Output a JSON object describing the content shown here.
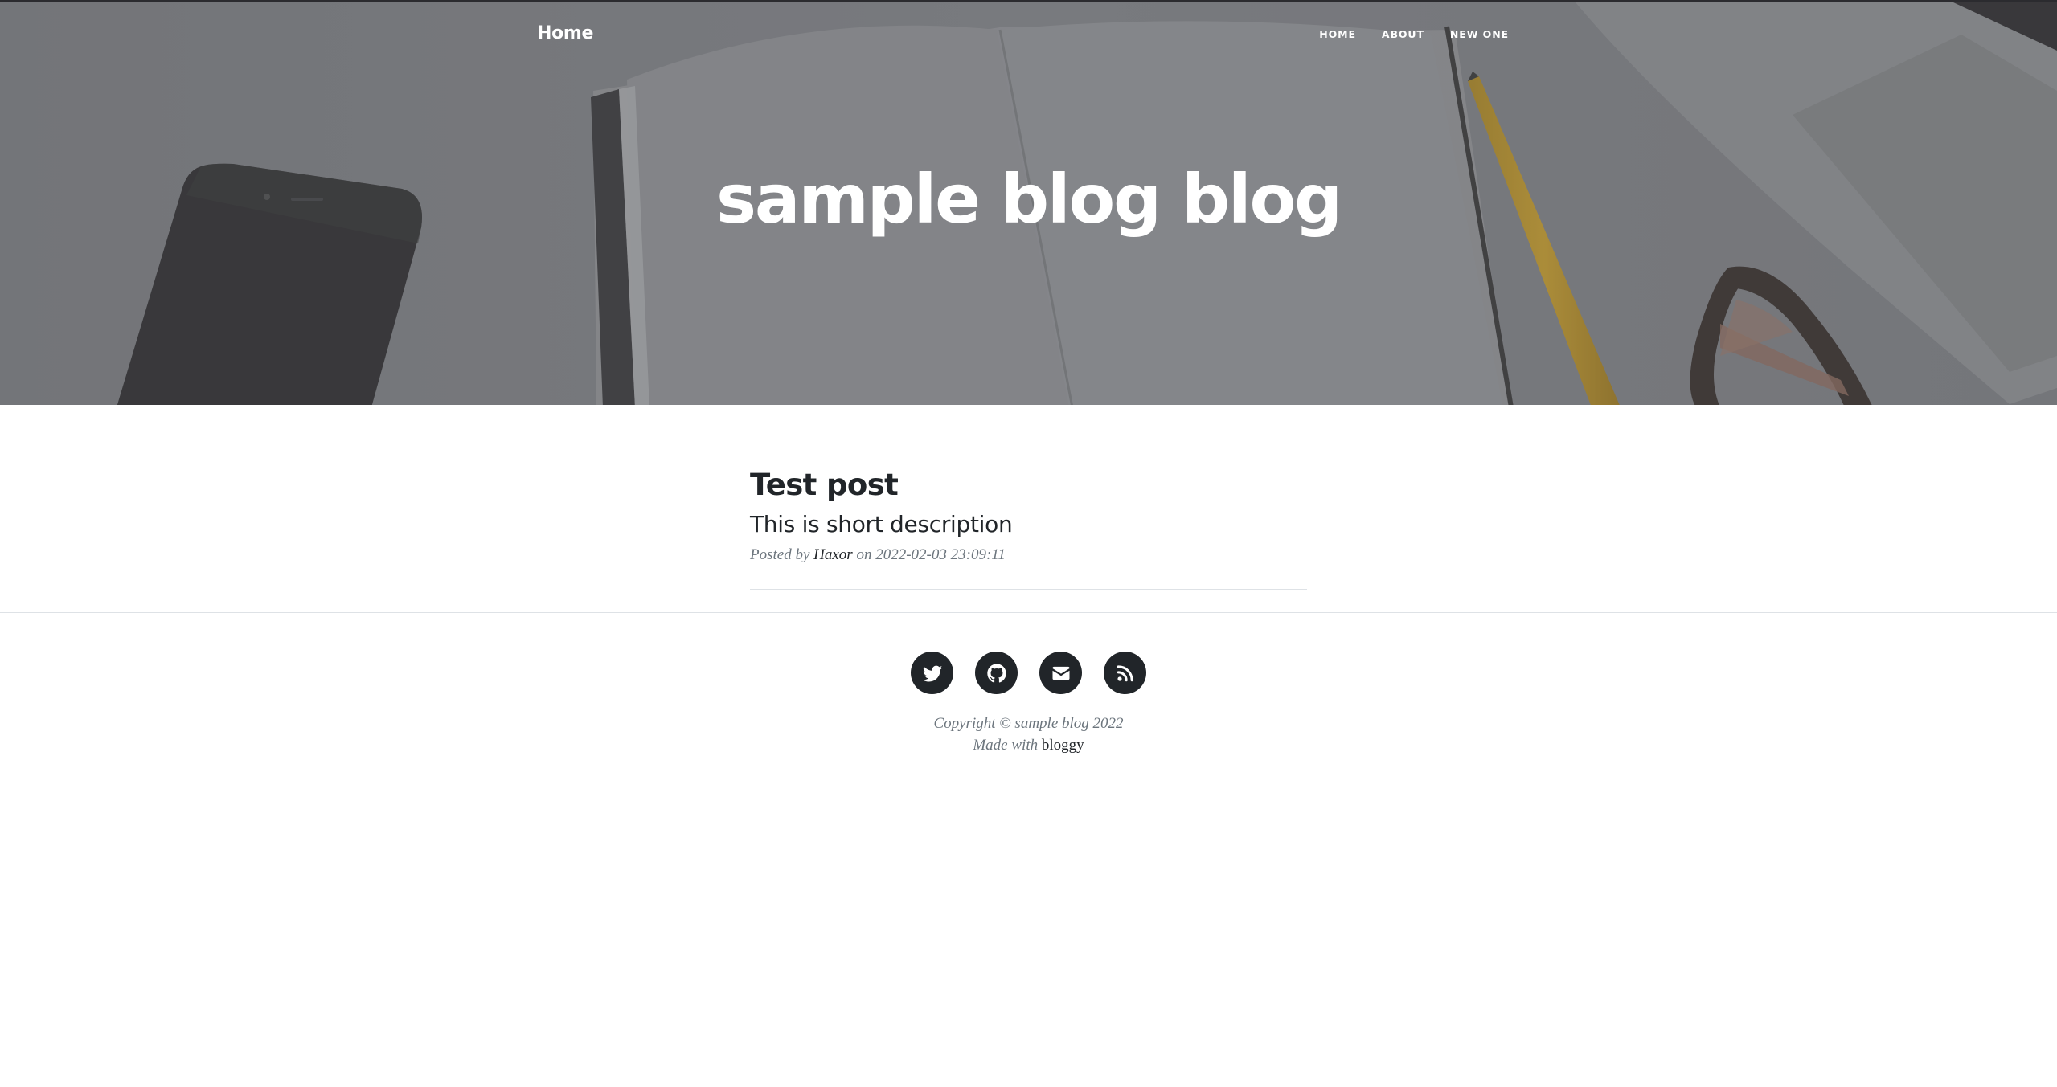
{
  "nav": {
    "brand": "Home",
    "links": [
      {
        "label": "HOME"
      },
      {
        "label": "ABOUT"
      },
      {
        "label": "NEW ONE"
      }
    ]
  },
  "hero": {
    "title": "sample blog blog"
  },
  "posts": [
    {
      "title": "Test post",
      "subtitle": "This is short description",
      "meta_prefix": "Posted by",
      "author": "Haxor",
      "meta_on": "on",
      "date": "2022-02-03 23:09:11"
    }
  ],
  "footer": {
    "social": [
      {
        "icon": "twitter-icon"
      },
      {
        "icon": "github-icon"
      },
      {
        "icon": "envelope-icon"
      },
      {
        "icon": "rss-icon"
      }
    ],
    "copyright": "Copyright © sample blog 2022",
    "made_with_prefix": "Made with",
    "made_with_link": "bloggy"
  },
  "colors": {
    "dark": "#212529",
    "muted": "#6c757d",
    "divider": "#dee2e6",
    "hero_overlay": "#8a8b90"
  }
}
